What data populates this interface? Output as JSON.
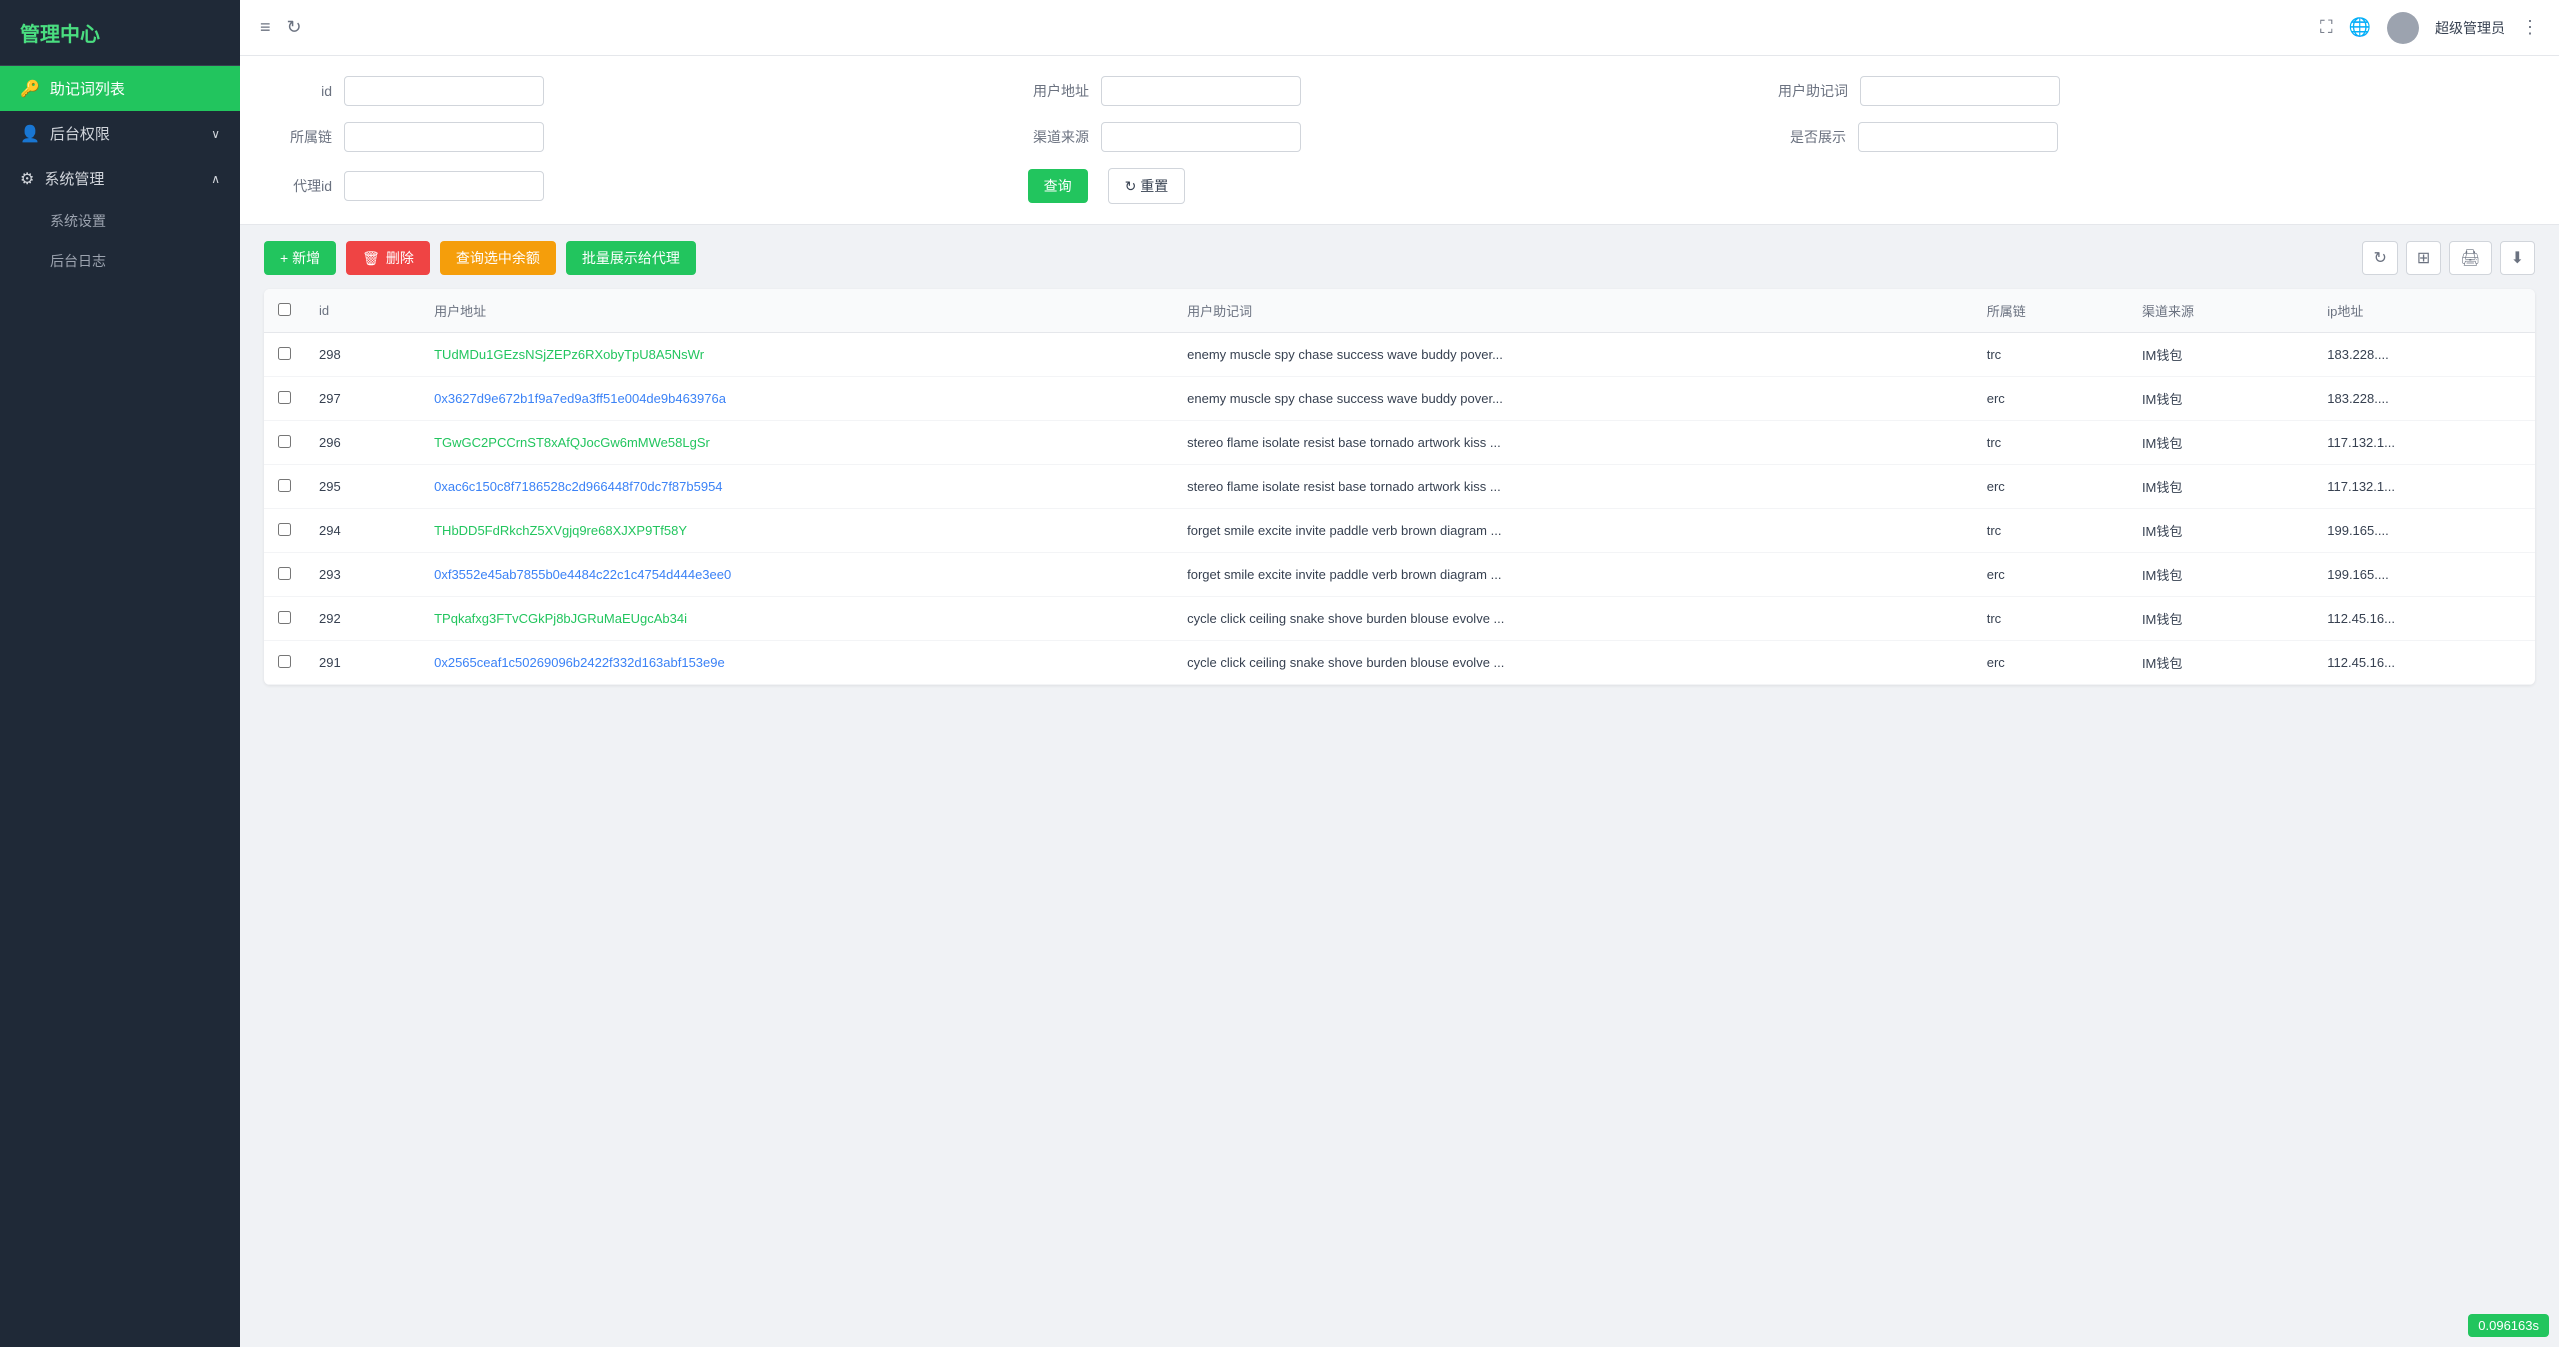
{
  "sidebar": {
    "logo": "管理中心",
    "items": [
      {
        "id": "mnemonic-list",
        "icon": "🔑",
        "label": "助记词列表",
        "active": true,
        "arrow": ""
      },
      {
        "id": "backend-perms",
        "icon": "👤",
        "label": "后台权限",
        "active": false,
        "arrow": "∨"
      },
      {
        "id": "system-mgmt",
        "icon": "⚙",
        "label": "系统管理",
        "active": false,
        "arrow": "∧"
      }
    ],
    "sub_items": [
      {
        "id": "system-settings",
        "label": "系统设置"
      },
      {
        "id": "backend-log",
        "label": "后台日志"
      }
    ]
  },
  "header": {
    "expand_icon": "≡",
    "refresh_icon": "↻",
    "fullscreen_icon": "⛶",
    "globe_icon": "🌐",
    "more_icon": "⋮",
    "admin_name": "超级管理员"
  },
  "filter": {
    "fields": [
      {
        "id": "id",
        "label": "id",
        "placeholder": ""
      },
      {
        "id": "user-address",
        "label": "用户地址",
        "placeholder": ""
      },
      {
        "id": "user-mnemonic",
        "label": "用户助记词",
        "placeholder": ""
      },
      {
        "id": "chain",
        "label": "所属链",
        "placeholder": ""
      },
      {
        "id": "channel-source",
        "label": "渠道来源",
        "placeholder": ""
      },
      {
        "id": "is-display",
        "label": "是否展示",
        "placeholder": ""
      },
      {
        "id": "agent-id",
        "label": "代理id",
        "placeholder": ""
      }
    ],
    "query_btn": "查询",
    "reset_btn": "重置"
  },
  "toolbar": {
    "add_btn": "+ 新增",
    "delete_btn": "删除",
    "query_selected_btn": "查询选中余额",
    "batch_display_btn": "批量展示给代理"
  },
  "table": {
    "columns": [
      "id",
      "用户地址",
      "用户助记词",
      "所属链",
      "渠道来源",
      "ip地址"
    ],
    "rows": [
      {
        "id": "298",
        "address": "TUdMDu1GEzsNSjZEPz6RXobyTpU8A5NsWr",
        "address_type": "trc_link",
        "mnemonic": "enemy muscle spy chase success wave buddy pover...",
        "chain": "trc",
        "channel": "IM钱包",
        "ip": "183.228...."
      },
      {
        "id": "297",
        "address": "0x3627d9e672b1f9a7ed9a3ff51e004de9b463976a",
        "address_type": "eth_link",
        "mnemonic": "enemy muscle spy chase success wave buddy pover...",
        "chain": "erc",
        "channel": "IM钱包",
        "ip": "183.228...."
      },
      {
        "id": "296",
        "address": "TGwGC2PCCrnST8xAfQJocGw6mMWe58LgSr",
        "address_type": "trc_link",
        "mnemonic": "stereo flame isolate resist base tornado artwork kiss ...",
        "chain": "trc",
        "channel": "IM钱包",
        "ip": "117.132.1..."
      },
      {
        "id": "295",
        "address": "0xac6c150c8f7186528c2d966448f70dc7f87b5954",
        "address_type": "eth_link",
        "mnemonic": "stereo flame isolate resist base tornado artwork kiss ...",
        "chain": "erc",
        "channel": "IM钱包",
        "ip": "117.132.1..."
      },
      {
        "id": "294",
        "address": "THbDD5FdRkchZ5XVgjq9re68XJXP9Tf58Y",
        "address_type": "trc_link",
        "mnemonic": "forget smile excite invite paddle verb brown diagram ...",
        "chain": "trc",
        "channel": "IM钱包",
        "ip": "199.165...."
      },
      {
        "id": "293",
        "address": "0xf3552e45ab7855b0e4484c22c1c4754d444e3ee0",
        "address_type": "eth_link",
        "mnemonic": "forget smile excite invite paddle verb brown diagram ...",
        "chain": "erc",
        "channel": "IM钱包",
        "ip": "199.165...."
      },
      {
        "id": "292",
        "address": "TPqkafxg3FTvCGkPj8bJGRuMaEUgcAb34i",
        "address_type": "trc_link",
        "mnemonic": "cycle click ceiling snake shove burden blouse evolve ...",
        "chain": "trc",
        "channel": "IM钱包",
        "ip": "112.45.16..."
      },
      {
        "id": "291",
        "address": "0x2565ceaf1c50269096b2422f332d163abf153e9e",
        "address_type": "eth_link",
        "mnemonic": "cycle click ceiling snake shove burden blouse evolve ...",
        "chain": "erc",
        "channel": "IM钱包",
        "ip": "112.45.16..."
      }
    ]
  },
  "badge": {
    "value": "0.096163s"
  }
}
